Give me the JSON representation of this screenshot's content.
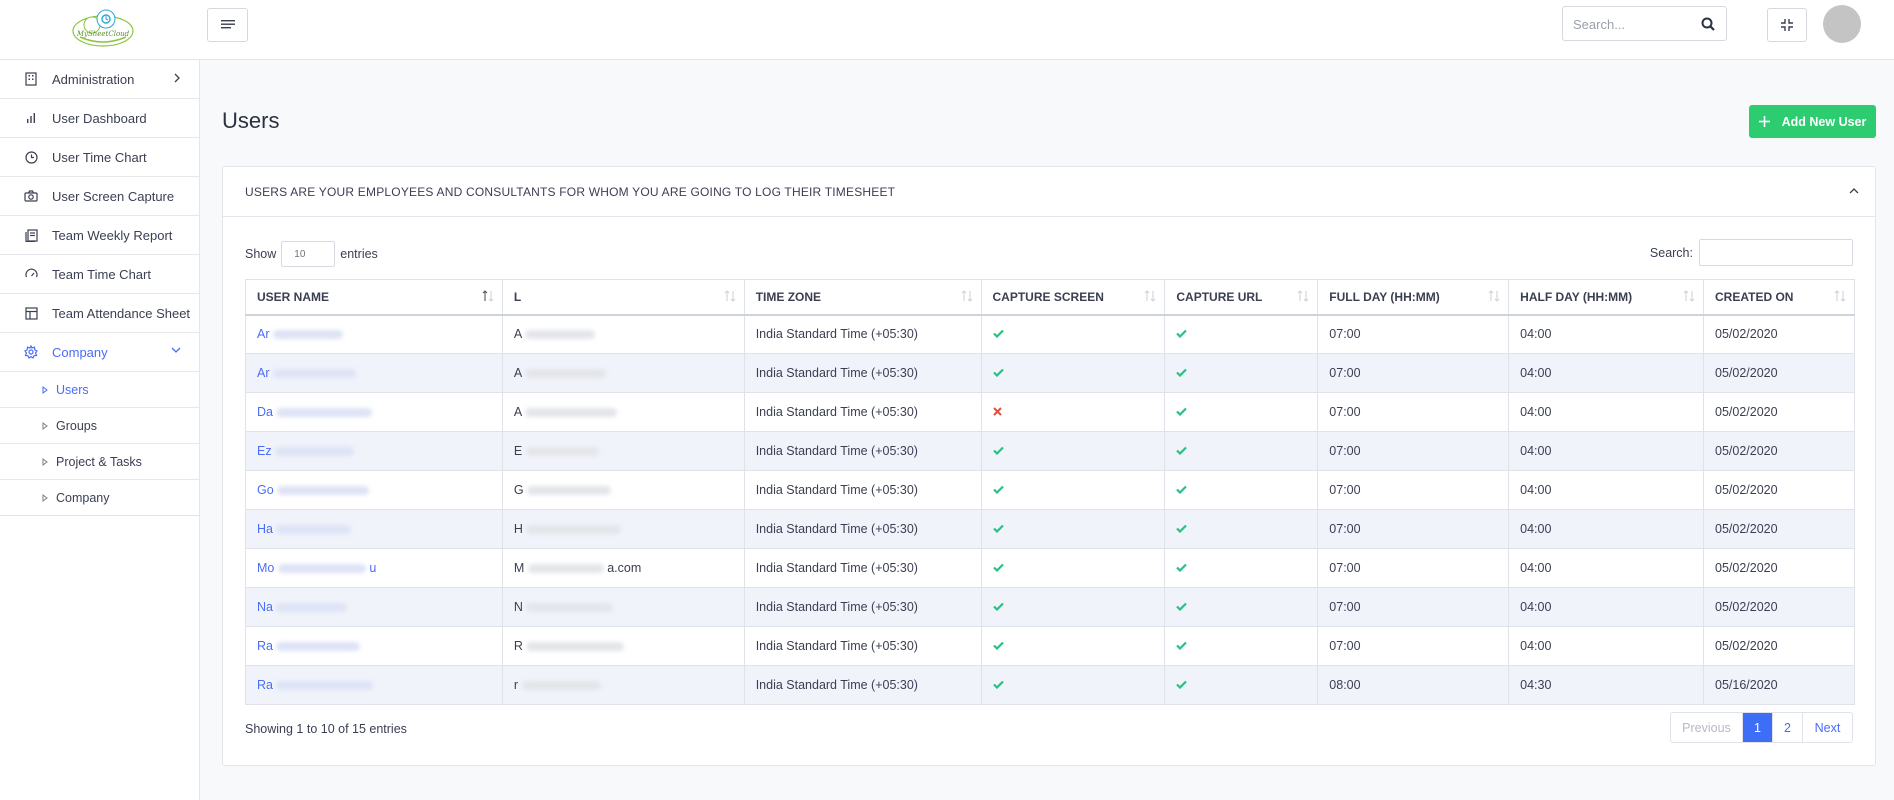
{
  "header": {
    "search_placeholder": "Search..."
  },
  "sidebar": {
    "items": [
      {
        "label": "Administration"
      },
      {
        "label": "User Dashboard"
      },
      {
        "label": "User Time Chart"
      },
      {
        "label": "User Screen Capture"
      },
      {
        "label": "Team Weekly Report"
      },
      {
        "label": "Team Time Chart"
      },
      {
        "label": "Team Attendance Sheet"
      },
      {
        "label": "Company"
      }
    ],
    "sub_items": [
      {
        "label": "Users"
      },
      {
        "label": "Groups"
      },
      {
        "label": "Project & Tasks"
      },
      {
        "label": "Company"
      }
    ]
  },
  "main": {
    "title": "Users",
    "add_button_label": "Add New User",
    "card_title": "USERS ARE YOUR EMPLOYEES AND CONSULTANTS FOR WHOM YOU ARE GOING TO LOG THEIR TIMESHEET",
    "length_prefix": "Show",
    "length_value": "10",
    "length_suffix": "entries",
    "search_label": "Search:",
    "info": "Showing 1 to 10 of 15 entries",
    "pager": {
      "previous": "Previous",
      "page1": "1",
      "page2": "2",
      "next": "Next"
    }
  },
  "table": {
    "columns": [
      "USER NAME",
      "L",
      "TIME ZONE",
      "CAPTURE SCREEN",
      "CAPTURE URL",
      "FULL DAY (HH:MM)",
      "HALF DAY (HH:MM)",
      "CREATED ON"
    ],
    "rows": [
      {
        "name": "Ar",
        "login": "A",
        "tz": "India Standard Time (+05:30)",
        "screen": "check",
        "url": "check",
        "full": "07:00",
        "half": "04:00",
        "created": "05/02/2020"
      },
      {
        "name": "Ar",
        "login": "A",
        "tz": "India Standard Time (+05:30)",
        "screen": "check",
        "url": "check",
        "full": "07:00",
        "half": "04:00",
        "created": "05/02/2020"
      },
      {
        "name": "Da",
        "login": "A",
        "tz": "India Standard Time (+05:30)",
        "screen": "cross",
        "url": "check",
        "full": "07:00",
        "half": "04:00",
        "created": "05/02/2020"
      },
      {
        "name": "Ez",
        "login": "E",
        "tz": "India Standard Time (+05:30)",
        "screen": "check",
        "url": "check",
        "full": "07:00",
        "half": "04:00",
        "created": "05/02/2020"
      },
      {
        "name": "Go",
        "login": "G",
        "tz": "India Standard Time (+05:30)",
        "screen": "check",
        "url": "check",
        "full": "07:00",
        "half": "04:00",
        "created": "05/02/2020"
      },
      {
        "name": "Ha",
        "login": "H",
        "tz": "India Standard Time (+05:30)",
        "screen": "check",
        "url": "check",
        "full": "07:00",
        "half": "04:00",
        "created": "05/02/2020"
      },
      {
        "name": "Mo",
        "name_tail": "u",
        "login": "M",
        "login_tail": "a.com",
        "tz": "India Standard Time (+05:30)",
        "screen": "check",
        "url": "check",
        "full": "07:00",
        "half": "04:00",
        "created": "05/02/2020"
      },
      {
        "name": "Na",
        "login": "N",
        "tz": "India Standard Time (+05:30)",
        "screen": "check",
        "url": "check",
        "full": "07:00",
        "half": "04:00",
        "created": "05/02/2020"
      },
      {
        "name": "Ra",
        "login": "R",
        "tz": "India Standard Time (+05:30)",
        "screen": "check",
        "url": "check",
        "full": "07:00",
        "half": "04:00",
        "created": "05/02/2020"
      },
      {
        "name": "Ra",
        "login": "r",
        "tz": "India Standard Time (+05:30)",
        "screen": "check",
        "url": "check",
        "full": "08:00",
        "half": "04:30",
        "created": "05/16/2020"
      }
    ]
  },
  "colors": {
    "accent": "#4a6cf7",
    "success": "#2ecc71",
    "danger": "#e74c3c",
    "check": "#27c281"
  }
}
